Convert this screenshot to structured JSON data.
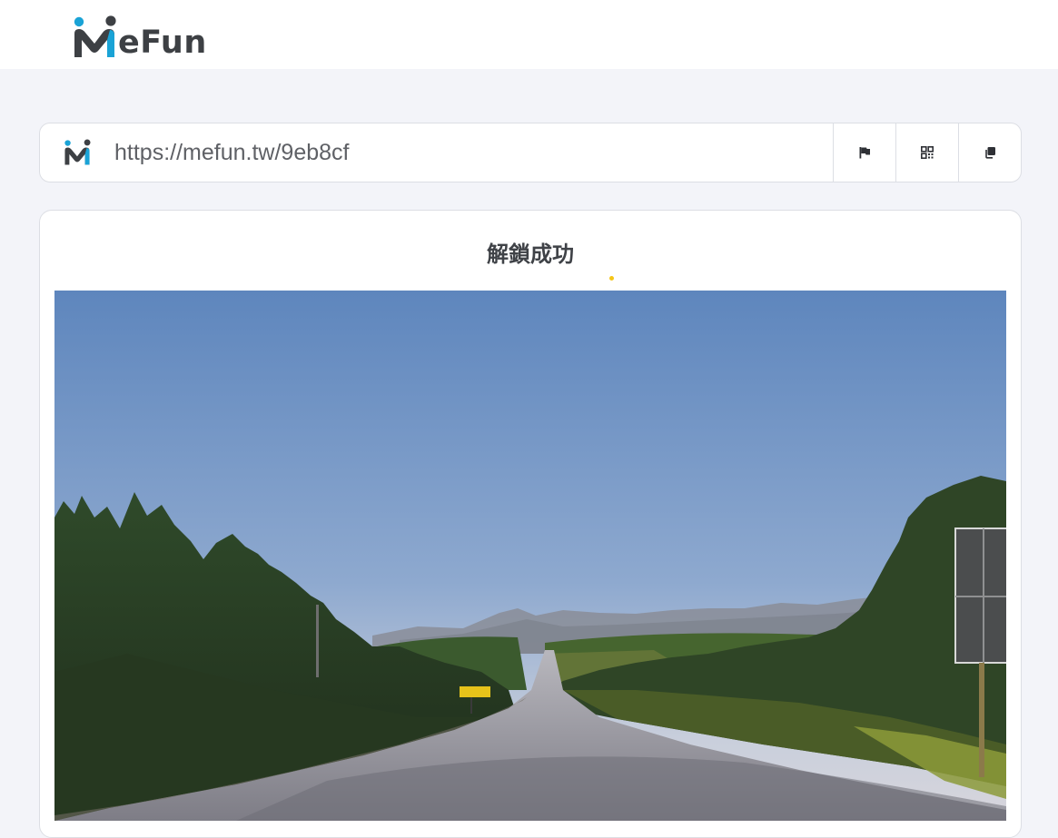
{
  "brand": {
    "name": "eFun",
    "colors": {
      "teal": "#1aa3d6",
      "dark": "#3d4044"
    }
  },
  "urlbar": {
    "url": "https://mefun.tw/9eb8cf",
    "actions": [
      {
        "name": "report",
        "icon": "flag-icon"
      },
      {
        "name": "qrcode",
        "icon": "qr-code-icon"
      },
      {
        "name": "copy",
        "icon": "copy-icon"
      }
    ]
  },
  "card": {
    "title": "解鎖成功",
    "image": {
      "subject": "road-landscape-photo",
      "sign_text": ""
    }
  }
}
